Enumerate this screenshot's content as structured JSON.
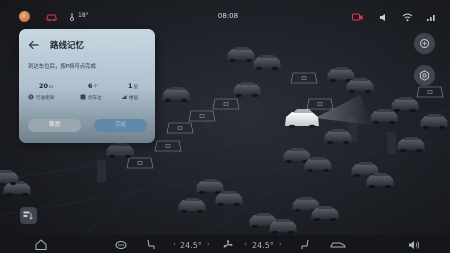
{
  "status": {
    "temperature": "18°",
    "clock": "08:08"
  },
  "card": {
    "title": "路线记忆",
    "description": "到达车位后，按P挡可点完成",
    "stats": [
      {
        "value": "20",
        "unit": "m",
        "label": "行驶距离"
      },
      {
        "value": "6",
        "unit": "个",
        "label": "停车位"
      },
      {
        "value": "1",
        "unit": "层",
        "label": "楼层"
      }
    ],
    "cancel_label": "取消",
    "done_label": "完成"
  },
  "climate": {
    "left_temp": "24.5°",
    "right_temp": "24.5°"
  },
  "colors": {
    "accent": "#5f89aa",
    "cancel": "#9aa6b0",
    "record_indicator": "#e0364a"
  },
  "icons": [
    "avatar",
    "car-outline-icon",
    "thermometer-icon",
    "record-icon",
    "volume-icon",
    "wifi-icon",
    "signal-icon",
    "back-arrow-icon",
    "route-distance-icon",
    "parking-icon",
    "floor-icon",
    "fullscreen-icon",
    "settings-icon",
    "legend-icon",
    "home-icon",
    "steering-heat-icon",
    "seat-left-icon",
    "fan-icon",
    "seat-right-icon",
    "car-side-icon",
    "speaker-icon"
  ]
}
